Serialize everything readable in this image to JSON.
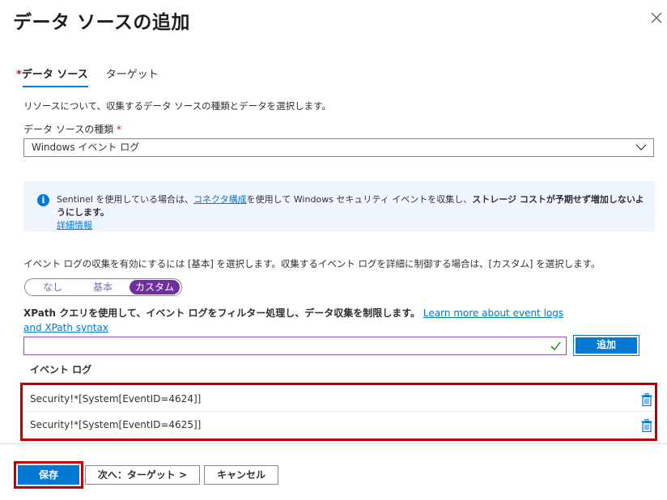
{
  "dialog": {
    "title": "データ ソースの追加"
  },
  "tabs": [
    {
      "required_marker": "*",
      "label": "データ ソース"
    },
    {
      "label": "ターゲット"
    }
  ],
  "source": {
    "description": "リソースについて、収集するデータ ソースの種類とデータを選択します。",
    "type_label": "データ ソースの種類",
    "required_marker": "*",
    "type_value": "Windows イベント ログ"
  },
  "info": {
    "text_before_link": "Sentinel を使用している場合は、",
    "link": "コネクタ構成",
    "text_after_link": "を使用して Windows セキュリティ イベントを収集し、",
    "bold_text": "ストレージ コストが予期せず増加しないようにします。",
    "details_link": "詳細情報"
  },
  "events": {
    "description": "イベント ログの収集を有効にするには [基本] を選択します。収集するイベント ログを詳細に制御する場合は、[カスタム] を選択します。",
    "toggle_options": [
      "なし",
      "基本",
      "カスタム"
    ],
    "selected_option": "カスタム",
    "xpath_text": "XPath クエリを使用して、イベント ログをフィルター処理し、データ収集を制限します。",
    "xpath_link": "Learn more about event logs and XPath syntax",
    "input_value": "",
    "add_button": "追加",
    "logs_label": "イベント ログ",
    "logs": [
      "Security!*[System[EventID=4624]]",
      "Security!*[System[EventID=4625]]"
    ]
  },
  "footer": {
    "save": "保存",
    "next": "次へ：ターゲット >",
    "cancel": "キャンセル"
  },
  "colors": {
    "accent": "#0078d4",
    "toggle_selected": "#6f2f9f",
    "highlight": "#c00000",
    "info_background": "#f0f6ff"
  }
}
